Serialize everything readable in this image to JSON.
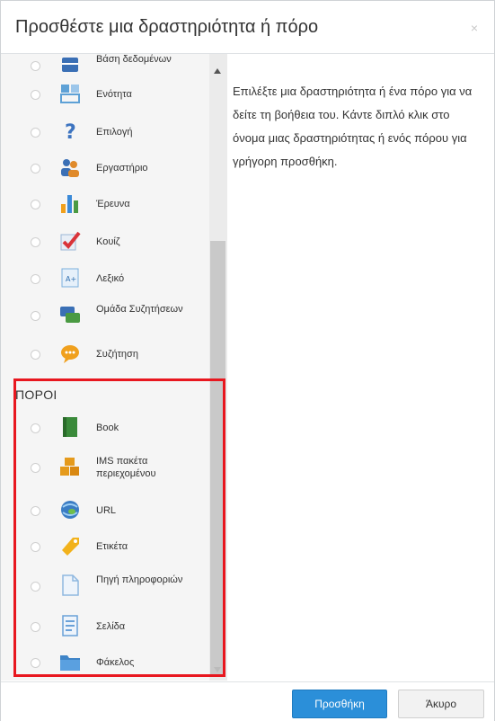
{
  "dialog": {
    "title": "Προσθέστε μια δραστηριότητα ή πόρο",
    "close_label": "×"
  },
  "activities": [
    {
      "label": "Βάση δεδομένων",
      "icon": "database-icon",
      "color": "#3a6fb5"
    },
    {
      "label": "Ενότητα",
      "icon": "lesson-icon",
      "color": "#5ea1d6"
    },
    {
      "label": "Επιλογή",
      "icon": "choice-question-icon",
      "color": "#3d74c0"
    },
    {
      "label": "Εργαστήριο",
      "icon": "workshop-people-icon",
      "color": "#e08a2a"
    },
    {
      "label": "Έρευνα",
      "icon": "survey-bar-chart-icon",
      "color": "#3b8ad8"
    },
    {
      "label": "Κουίζ",
      "icon": "quiz-checkmark-icon",
      "color": "#d9343a"
    },
    {
      "label": "Λεξικό",
      "icon": "glossary-icon",
      "color": "#7bb0dd"
    },
    {
      "label": "Ομάδα Συζητήσεων",
      "icon": "forum-icon",
      "color": "#4a9a42"
    },
    {
      "label": "Συζήτηση",
      "icon": "chat-bubble-icon",
      "color": "#f0a01d"
    }
  ],
  "resources_section": {
    "title": "ΠΟΡΟΙ",
    "items": [
      {
        "label": "Book",
        "icon": "book-icon",
        "color": "#3a8a3a"
      },
      {
        "label": "IMS πακέτα περιεχομένου",
        "icon": "ims-package-icon",
        "color": "#e59a1c"
      },
      {
        "label": "URL",
        "icon": "url-globe-icon",
        "color": "#3a7cc4"
      },
      {
        "label": "Ετικέτα",
        "icon": "label-tag-icon",
        "color": "#f2b21b"
      },
      {
        "label": "Πηγή πληροφοριών",
        "icon": "file-document-icon",
        "color": "#8fb8e0"
      },
      {
        "label": "Σελίδα",
        "icon": "page-icon",
        "color": "#6aa1d8"
      },
      {
        "label": "Φάκελος",
        "icon": "folder-icon",
        "color": "#3f84c7"
      }
    ]
  },
  "help_text": "Επιλέξτε μια δραστηριότητα ή ένα πόρο για να δείτε τη βοήθεια του. Κάντε διπλό κλικ στο όνομα μιας δραστηριότητας ή ενός πόρου για γρήγορη προσθήκη.",
  "footer": {
    "add_label": "Προσθήκη",
    "cancel_label": "Άκυρο"
  },
  "colors": {
    "primary": "#2b8fd9",
    "highlight": "#e8171f"
  }
}
